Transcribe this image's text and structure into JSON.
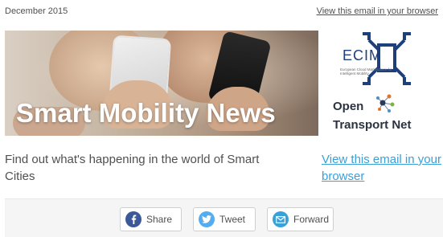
{
  "header": {
    "date": "December 2015",
    "view_in_browser": "View this email in your browser"
  },
  "hero": {
    "title": "Smart Mobility News"
  },
  "logos": {
    "ecim": {
      "text": "ECIM",
      "tagline": "European Cloud Marketplace for Intelligent Mobility"
    },
    "otn": {
      "line1": "Open",
      "line2": "Transport Net"
    }
  },
  "intro": {
    "text": "Find out what's happening in the world of Smart Cities",
    "view_in_browser": "View this email in your browser"
  },
  "share_bar": {
    "buttons": [
      {
        "label": "Share",
        "icon": "facebook-icon",
        "color": "#3b5998"
      },
      {
        "label": "Tweet",
        "icon": "twitter-icon",
        "color": "#55acee"
      },
      {
        "label": "Forward",
        "icon": "email-icon",
        "color": "#3aa0d8"
      }
    ]
  }
}
